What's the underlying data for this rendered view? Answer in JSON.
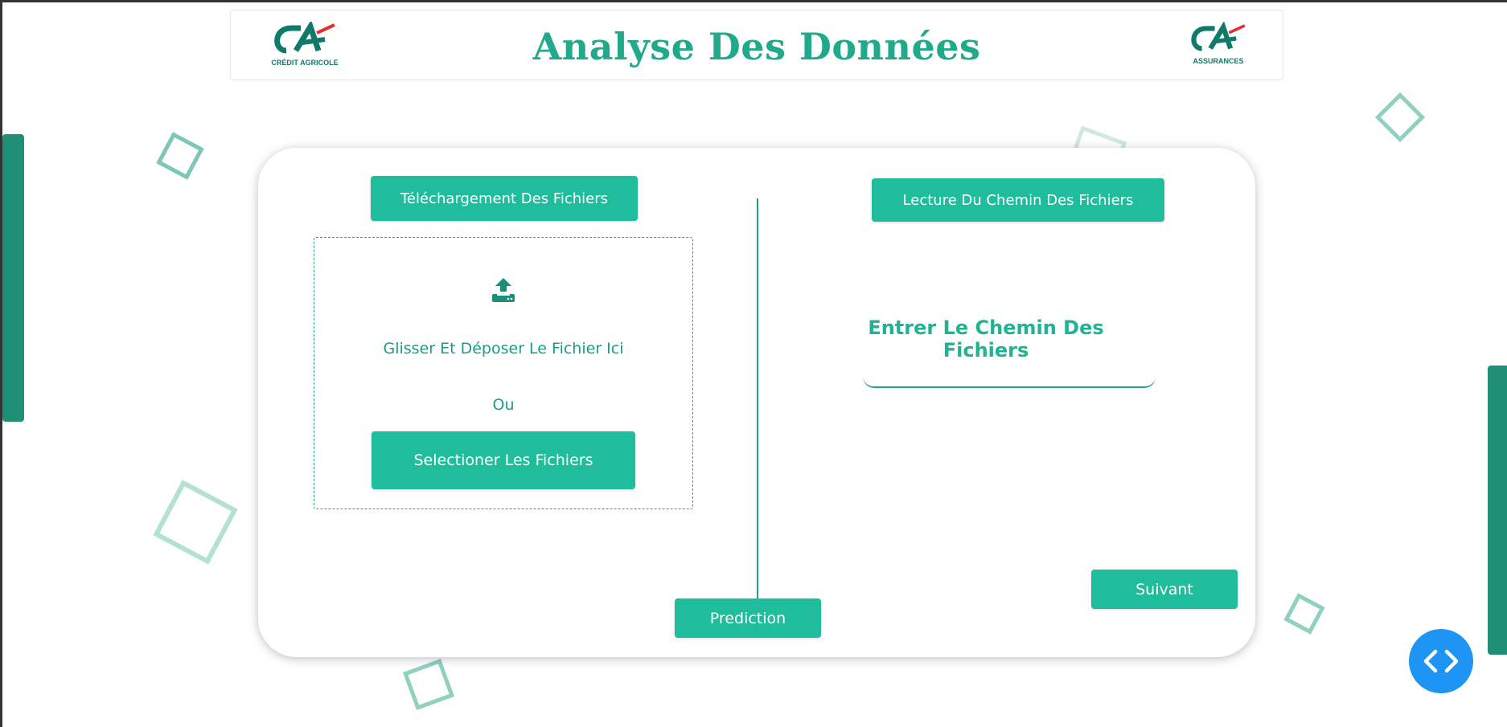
{
  "header": {
    "title": "Analyse Des Données",
    "logo_left_text": "CRÉDIT AGRICOLE",
    "logo_right_text": "ASSURANCES"
  },
  "upload": {
    "tab_label": "Téléchargement Des Fichiers",
    "drop_text": "Glisser Et Déposer Le Fichier Ici",
    "or_text": "Ou",
    "select_button": "Selectioner Les Fichiers"
  },
  "path": {
    "tab_label": "Lecture Du Chemin Des Fichiers",
    "input_label": "Entrer Le Chemin Des Fichiers",
    "input_value": ""
  },
  "actions": {
    "next_button": "Suivant",
    "prediction_button": "Prediction"
  },
  "colors": {
    "accent": "#1fbd9c",
    "title": "#20a98b",
    "side_bar": "#1f8f76",
    "fab": "#1e94f5"
  },
  "icons": {
    "upload": "upload-tray-icon",
    "code": "code-brackets-icon"
  }
}
